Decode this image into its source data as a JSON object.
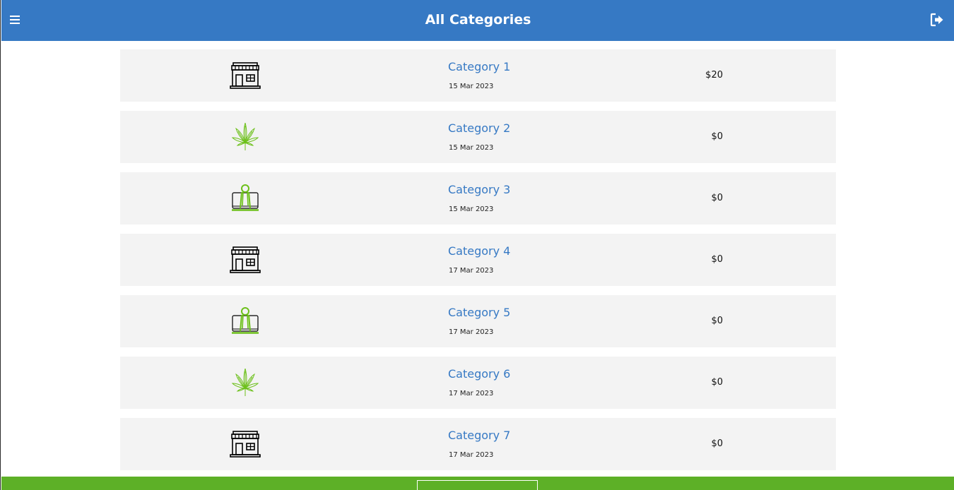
{
  "header": {
    "title": "All Categories",
    "background_color": "#3679c4",
    "menu_icon": "hamburger-menu-icon",
    "logout_icon": "sign-out-icon"
  },
  "categories": [
    {
      "name": "Category 1",
      "date": "15 Mar 2023",
      "amount": "$20",
      "icon": "storefront-icon"
    },
    {
      "name": "Category 2",
      "date": "15 Mar 2023",
      "amount": "$0",
      "icon": "cannabis-leaf-icon"
    },
    {
      "name": "Category 3",
      "date": "15 Mar 2023",
      "amount": "$0",
      "icon": "binder-clip-icon"
    },
    {
      "name": "Category 4",
      "date": "17 Mar 2023",
      "amount": "$0",
      "icon": "storefront-icon"
    },
    {
      "name": "Category 5",
      "date": "17 Mar 2023",
      "amount": "$0",
      "icon": "binder-clip-icon"
    },
    {
      "name": "Category 6",
      "date": "17 Mar 2023",
      "amount": "$0",
      "icon": "cannabis-leaf-icon"
    },
    {
      "name": "Category 7",
      "date": "17 Mar 2023",
      "amount": "$0",
      "icon": "storefront-icon"
    }
  ],
  "colors": {
    "link": "#3679c4",
    "row_background": "#f3f3f3",
    "footer": "#5db027",
    "icon_green": "#6cc01a"
  },
  "footer": {
    "button_label": ""
  }
}
